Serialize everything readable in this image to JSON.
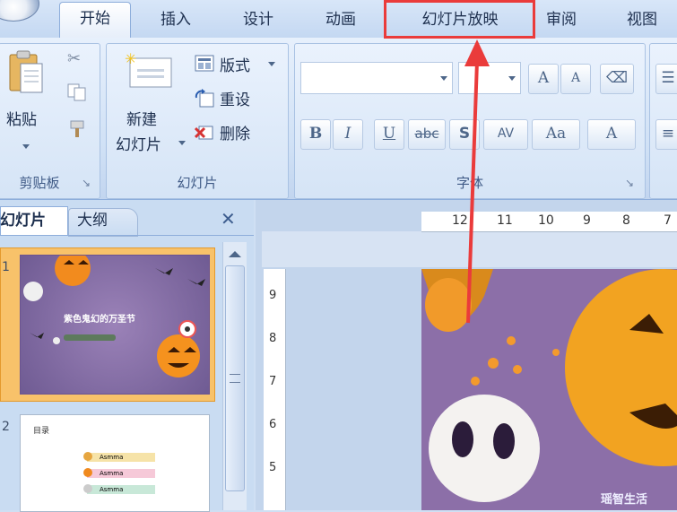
{
  "tabs": [
    "开始",
    "插入",
    "设计",
    "动画",
    "幻灯片放映",
    "审阅",
    "视图"
  ],
  "active_tab": "开始",
  "clipboard": {
    "paste_label": "粘贴",
    "group_label": "剪贴板"
  },
  "slides_group": {
    "new_slide_line1": "新建",
    "new_slide_line2": "幻灯片",
    "layout_label": "版式",
    "reset_label": "重设",
    "delete_label": "删除",
    "group_label": "幻灯片"
  },
  "font_group": {
    "group_label": "字体",
    "bold": "B",
    "italic": "I",
    "underline": "U",
    "strike": "abc",
    "shadow": "S",
    "spacing": "AV",
    "case": "Aa",
    "grow": "A",
    "shrink": "A",
    "color": "A"
  },
  "left_panel": {
    "tab_slides": "幻灯片",
    "tab_outline": "大纲",
    "close": "✕"
  },
  "thumb1": {
    "number": "1",
    "title": "紫色鬼幻的万圣节"
  },
  "thumb2": {
    "number": "2",
    "title": "目录",
    "items": [
      "Asmma",
      "Asmma",
      "Asmma"
    ]
  },
  "hruler": {
    "labels": [
      "12",
      "11",
      "10",
      "9",
      "8",
      "7"
    ]
  },
  "vruler": {
    "labels": [
      "9",
      "8",
      "7",
      "6",
      "5"
    ]
  },
  "watermark": {
    "text": "瑶智生活"
  },
  "colors": {
    "highlight": "#ea3b3b",
    "slide_bg": "#8c6fa8"
  }
}
